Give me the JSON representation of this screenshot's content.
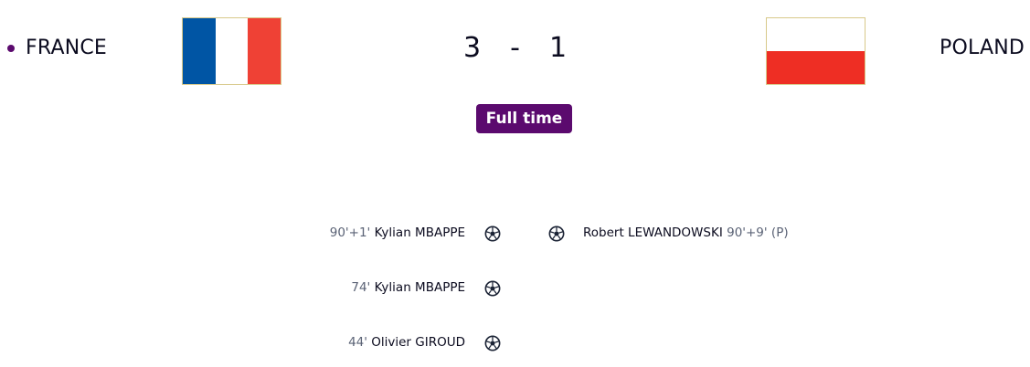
{
  "match": {
    "home_team": "FRANCE",
    "away_team": "POLAND",
    "home_score": "3",
    "separator": "-",
    "away_score": "1",
    "status": "Full time"
  },
  "home_goals": [
    {
      "minute": "90'+1'",
      "player": "Kylian MBAPPE"
    },
    {
      "minute": "74'",
      "player": "Kylian MBAPPE"
    },
    {
      "minute": "44'",
      "player": "Olivier GIROUD"
    }
  ],
  "away_goals": [
    {
      "player": "Robert LEWANDOWSKI",
      "minute": "90'+9'",
      "note": "(P)"
    }
  ],
  "colors": {
    "accent": "#5b0a6e",
    "france_blue": "#0055a4",
    "france_red": "#ef4135",
    "poland_red": "#ee2e24"
  },
  "icons": [
    "soccer-ball-icon"
  ]
}
